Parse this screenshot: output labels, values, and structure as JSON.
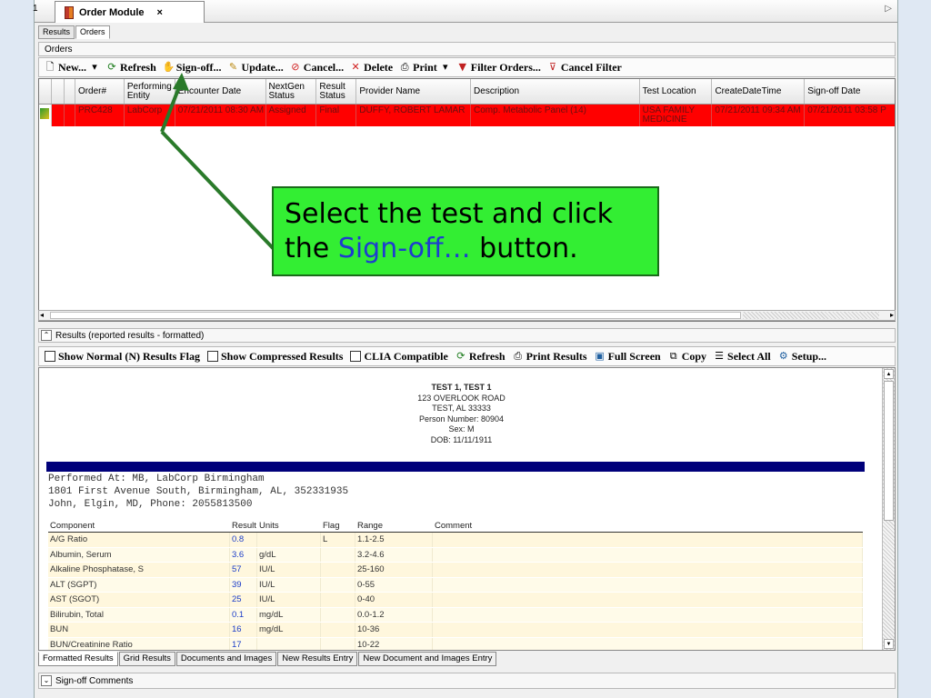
{
  "window": {
    "edge_number": "1",
    "doc_tab_label": "Order Module",
    "doc_tab_close": "×",
    "scroll_right_glyph": "▷"
  },
  "view_tabs": [
    "Results",
    "Orders"
  ],
  "orders_section": "Orders",
  "toolbar": {
    "new": "New...",
    "refresh": "Refresh",
    "signoff": "Sign-off...",
    "update": "Update...",
    "cancel": "Cancel...",
    "delete": "Delete",
    "print": "Print",
    "filter": "Filter Orders...",
    "cancel_filter": "Cancel Filter"
  },
  "grid": {
    "headers": [
      "Order#",
      "Performing Entity",
      "Encounter Date",
      "NextGen Status",
      "Result Status",
      "Provider Name",
      "Description",
      "Test Location",
      "CreateDateTime",
      "Sign-off Date"
    ],
    "row": [
      "PRC428",
      "LabCorp",
      "07/21/2011 08:30 AM",
      "Assigned",
      "Final",
      "DUFFY, ROBERT LAMAR",
      "Comp. Metabolic Panel (14)",
      "USA FAMILY MEDICINE",
      "07/21/2011 09:34 AM",
      "07/21/2011 03:58 P"
    ]
  },
  "results_section": "Results (reported results - formatted)",
  "results_toolbar": {
    "show_normal": "Show Normal (N) Results Flag",
    "show_compressed": "Show Compressed Results",
    "clia": "CLIA Compatible",
    "refresh": "Refresh",
    "print_results": "Print Results",
    "full_screen": "Full Screen",
    "copy": "Copy",
    "select_all": "Select All",
    "setup": "Setup..."
  },
  "patient": {
    "name": "TEST 1, TEST 1",
    "address1": "123 OVERLOOK ROAD",
    "address2": "TEST, AL 33333",
    "person_number": "Person Number: 80904",
    "sex": "Sex: M",
    "dob": "DOB: 11/11/1911"
  },
  "lab": {
    "performed_at": "Performed At: MB, LabCorp Birmingham",
    "address": "1801 First Avenue South, Birmingham, AL, 352331935",
    "contact": "John, Elgin, MD, Phone: 2055813500"
  },
  "results_table": {
    "headers": [
      "Component",
      "Result",
      "Units",
      "Flag",
      "Range",
      "Comment"
    ],
    "rows": [
      [
        "A/G Ratio",
        "0.8",
        "",
        "L",
        "1.1-2.5",
        ""
      ],
      [
        "Albumin, Serum",
        "3.6",
        "g/dL",
        "",
        "3.2-4.6",
        ""
      ],
      [
        "Alkaline Phosphatase, S",
        "57",
        "IU/L",
        "",
        "25-160",
        ""
      ],
      [
        "ALT (SGPT)",
        "39",
        "IU/L",
        "",
        "0-55",
        ""
      ],
      [
        "AST (SGOT)",
        "25",
        "IU/L",
        "",
        "0-40",
        ""
      ],
      [
        "Bilirubin, Total",
        "0.1",
        "mg/dL",
        "",
        "0.0-1.2",
        ""
      ],
      [
        "BUN",
        "16",
        "mg/dL",
        "",
        "10-36",
        ""
      ],
      [
        "BUN/Creatinine Ratio",
        "17",
        "",
        "",
        "10-22",
        ""
      ]
    ]
  },
  "bottom_tabs": [
    "Formatted Results",
    "Grid Results",
    "Documents and Images",
    "New Results Entry",
    "New Document and Images Entry"
  ],
  "signoff_comments": "Sign-off Comments",
  "callout": {
    "line1": "Select the test and click",
    "line2_prefix": "the ",
    "line2_highlight": "Sign-off…",
    "line2_suffix": " button."
  },
  "colors": {
    "row_highlight": "#ff0000",
    "callout_bg": "#33ee33",
    "arrow": "#2a7a2a",
    "highlight_text": "#1e3ccf"
  }
}
